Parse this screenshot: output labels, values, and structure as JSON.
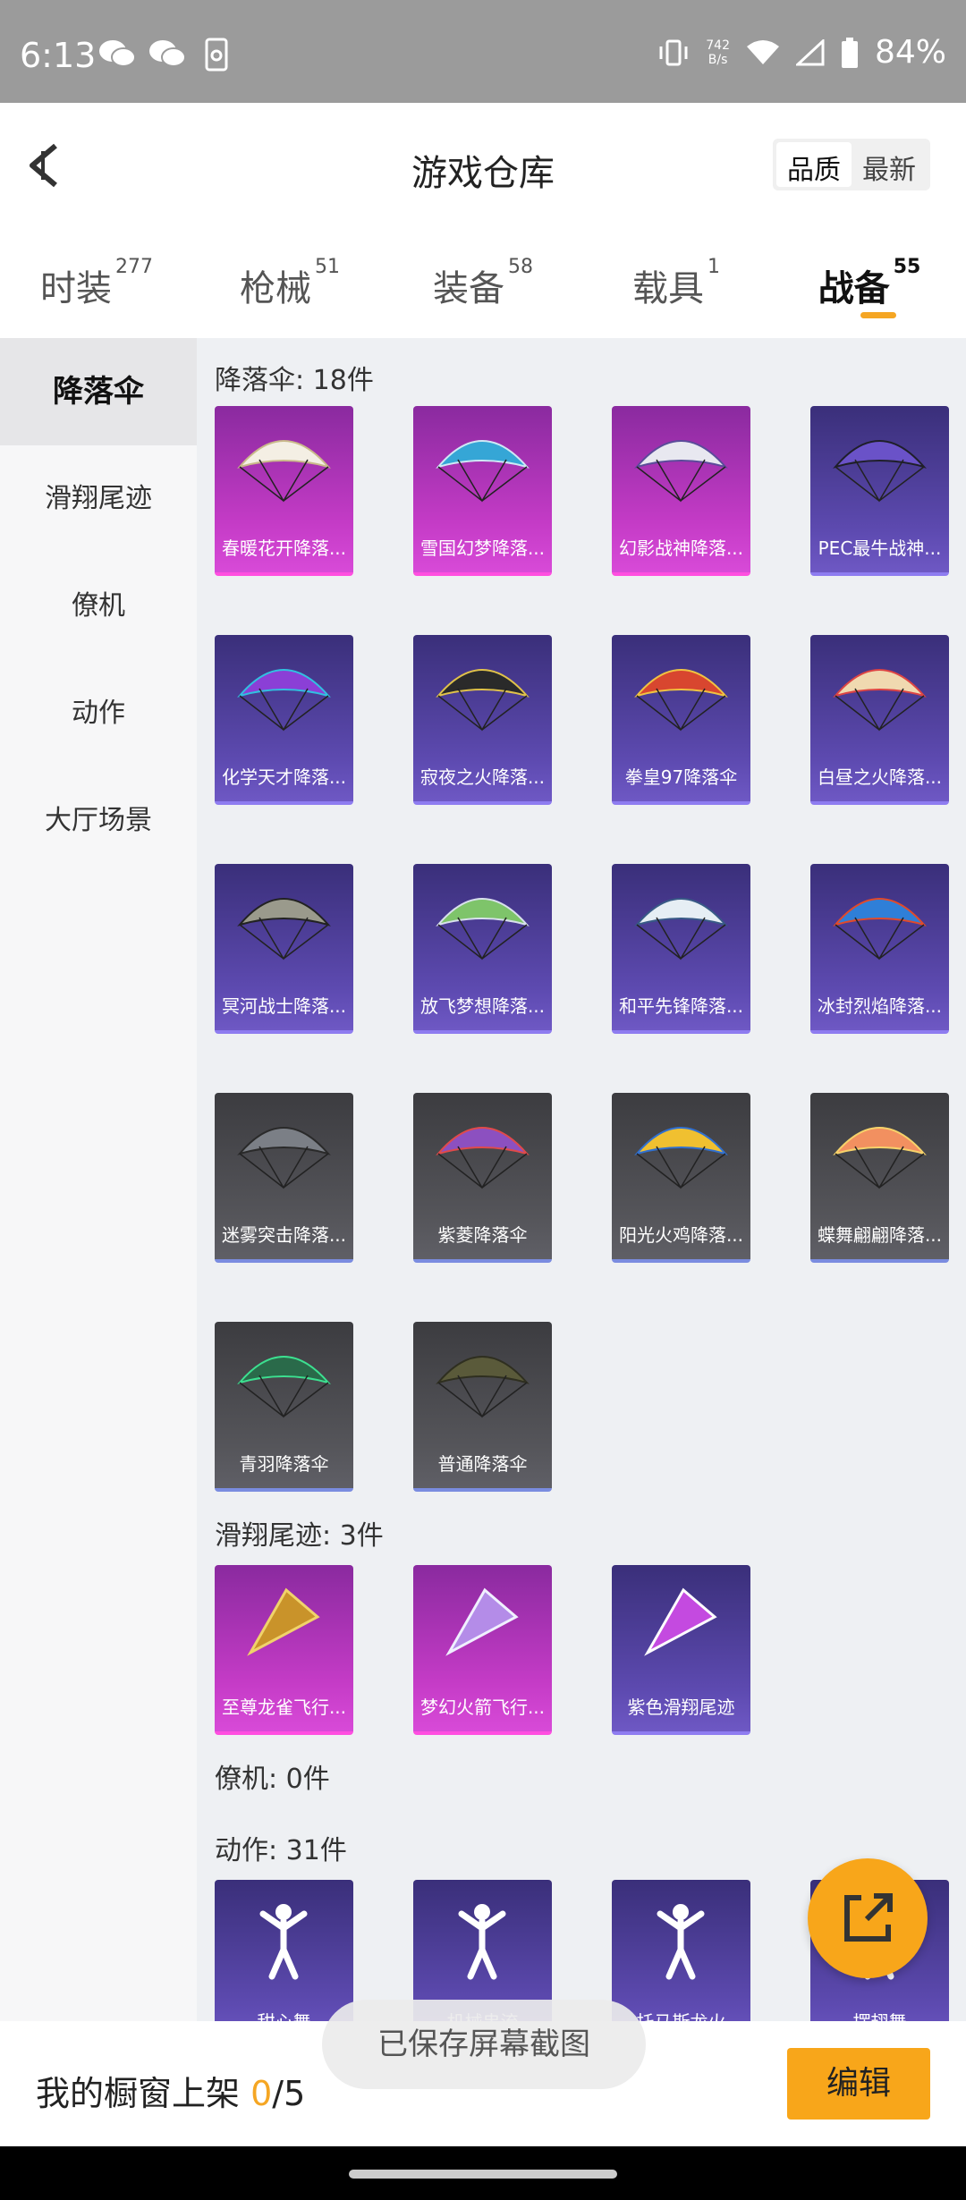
{
  "status_bar": {
    "time": "6:13",
    "speed_value": "742",
    "speed_unit": "B/s",
    "battery": "84%"
  },
  "header": {
    "title": "游戏仓库",
    "sort_options": [
      "品质",
      "最新"
    ]
  },
  "tabs": [
    {
      "label": "时装",
      "count": "277"
    },
    {
      "label": "枪械",
      "count": "51"
    },
    {
      "label": "装备",
      "count": "58"
    },
    {
      "label": "载具",
      "count": "1"
    },
    {
      "label": "战备",
      "count": "55"
    }
  ],
  "sidebar": [
    "降落伞",
    "滑翔尾迹",
    "僚机",
    "动作",
    "大厅场景"
  ],
  "sections": {
    "parachute": {
      "title": "降落伞: 18件",
      "items": [
        "春暖花开降落...",
        "雪国幻梦降落...",
        "幻影战神降落...",
        "PEC最牛战神...",
        "化学天才降落...",
        "寂夜之火降落...",
        "拳皇97降落伞",
        "白昼之火降落...",
        "冥河战士降落...",
        "放飞梦想降落...",
        "和平先锋降落...",
        "冰封烈焰降落...",
        "迷雾突击降落...",
        "紫菱降落伞",
        "阳光火鸡降落...",
        "蝶舞翩翩降落...",
        "青羽降落伞",
        "普通降落伞"
      ]
    },
    "trail": {
      "title": "滑翔尾迹: 3件",
      "items": [
        "至尊龙雀飞行...",
        "梦幻火箭飞行...",
        "紫色滑翔尾迹"
      ]
    },
    "wingman": {
      "title": "僚机: 0件"
    },
    "emote": {
      "title": "动作: 31件",
      "items": [
        "甜心舞",
        "机械串流",
        "托马斯龙火",
        "摆翅舞"
      ]
    }
  },
  "bottom": {
    "label_prefix": "我的橱窗上架 ",
    "count": "0",
    "total": "/5",
    "edit": "编辑"
  },
  "toast": "已保存屏幕截图"
}
